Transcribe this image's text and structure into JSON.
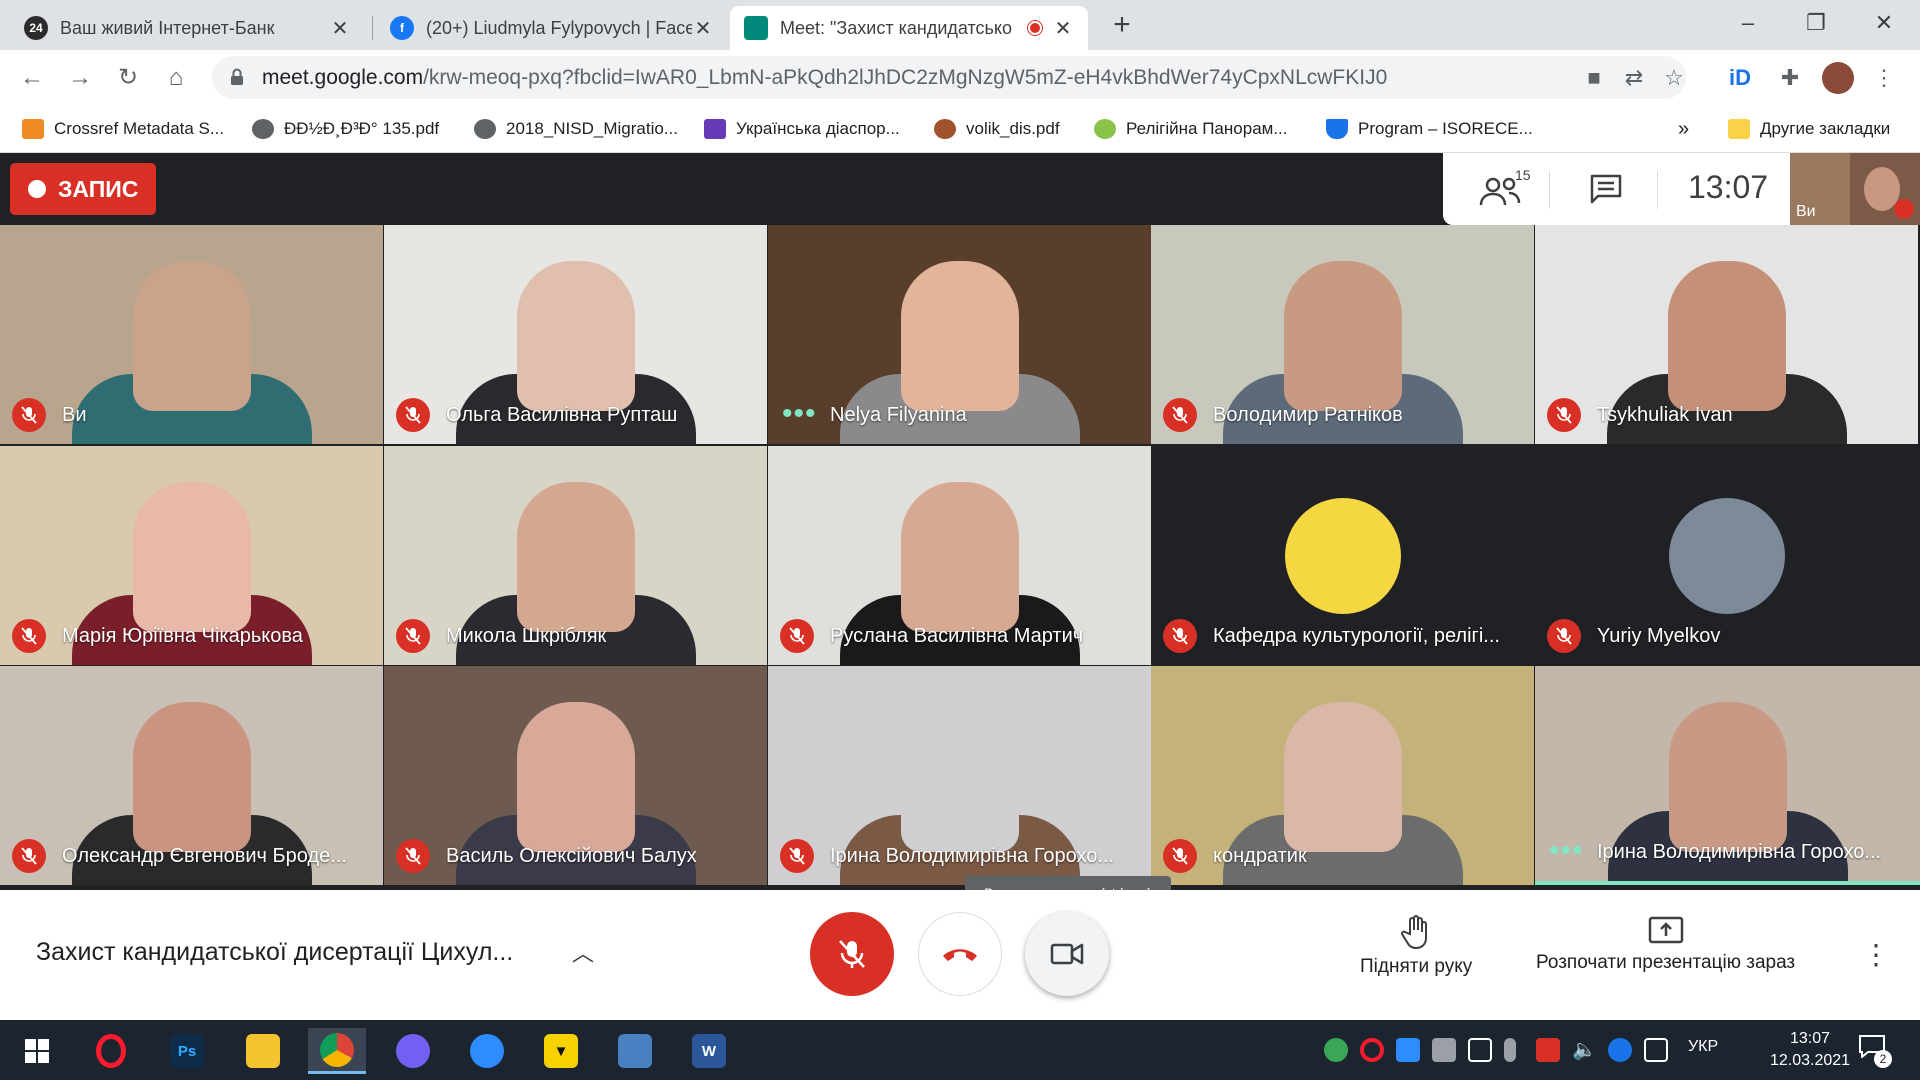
{
  "tabs": [
    {
      "title": "Ваш живий Інтернет-Банк",
      "icon": "privat24-icon",
      "icon_text": "24"
    },
    {
      "title": "(20+) Liudmyla Fylypovych | Face",
      "icon": "facebook-icon",
      "icon_text": "f"
    },
    {
      "title": "Meet: \"Захист кандидатсько",
      "icon": "google-meet-icon",
      "icon_text": ""
    }
  ],
  "address": {
    "domain": "meet.google.com",
    "path": "/krw-meoq-pxq?fbclid=IwAR0_LbmN-aPkQdh2lJhDC2zMgNzgW5mZ-eH4vkBhdWer74yCpxNLcwFKIJ0"
  },
  "bookmarks": [
    {
      "label": "Crossref Metadata S...",
      "color": "#f08a24"
    },
    {
      "label": "ÐÐ½Ð¸Ð³Ð° 135.pdf",
      "color": "#5f6368"
    },
    {
      "label": "2018_NISD_Migratio...",
      "color": "#5f6368"
    },
    {
      "label": "Українська діаспор...",
      "color": "#673ab7"
    },
    {
      "label": "volik_dis.pdf",
      "color": "#a0522d"
    },
    {
      "label": "Релігійна Панорам...",
      "color": "#8bc34a"
    },
    {
      "label": "Program – ISORECE...",
      "color": "#1a73e8"
    }
  ],
  "bookmarks_more": "»",
  "other_bookmarks": "Другие закладки",
  "meet": {
    "recording_label": "ЗАПИС",
    "participants_count": "15",
    "time": "13:07",
    "self_label": "Ви",
    "tooltip": "Вимкнути камеру (ctrl + e)",
    "title": "Захист кандидатської дисертації Цихул...",
    "raise_hand": "Підняти руку",
    "present": "Розпочати презентацію зараз"
  },
  "participants": [
    {
      "name": "Ви",
      "muted": true,
      "bg": "#b9a48e",
      "skin": "#c9a38a",
      "cloth": "#2f6d72",
      "kind": "video"
    },
    {
      "name": "Ольга Василівна Рупташ",
      "muted": true,
      "bg": "#e8e6e2",
      "skin": "#e0bfae",
      "cloth": "#2a2a2e",
      "kind": "video"
    },
    {
      "name": "Nelya Filyanina",
      "muted": false,
      "bg": "#5a3e2c",
      "skin": "#e2b49a",
      "cloth": "#8a8a8a",
      "kind": "video"
    },
    {
      "name": "Володимир Ратніков",
      "muted": true,
      "bg": "#c9c8bd",
      "skin": "#c89a82",
      "cloth": "#5c6a7a",
      "kind": "video"
    },
    {
      "name": "Tsykhuliak Ivan",
      "muted": true,
      "bg": "#e4e4e4",
      "skin": "#c49078",
      "cloth": "#2a2a2a",
      "kind": "video"
    },
    {
      "name": "Марія Юріївна Чікарькова",
      "muted": true,
      "bg": "#d9c9ae",
      "skin": "#e8b8a8",
      "cloth": "#7a1f2a",
      "kind": "video"
    },
    {
      "name": "Микола Шкрібляк",
      "muted": true,
      "bg": "#d8d4c6",
      "skin": "#d4a890",
      "cloth": "#2a2a30",
      "kind": "video"
    },
    {
      "name": "Руслана Василівна Мартич",
      "muted": true,
      "bg": "#dfdfdc",
      "skin": "#d6aa92",
      "cloth": "#1a1a1a",
      "kind": "video"
    },
    {
      "name": "Кафедра культурології, релігі...",
      "muted": true,
      "bg": "#202124",
      "avatar": "#f5d742",
      "kind": "avatar"
    },
    {
      "name": "Yuriy Myelkov",
      "muted": true,
      "bg": "#202124",
      "avatar": "#7d8a9a",
      "kind": "avatar"
    },
    {
      "name": "Олександр Євгенович Броде...",
      "muted": true,
      "bg": "#c8c0b4",
      "skin": "#c99580",
      "cloth": "#2a2a2a",
      "kind": "video"
    },
    {
      "name": "Василь Олексійович Балух",
      "muted": true,
      "bg": "#6e5a4e",
      "skin": "#d8a898",
      "cloth": "#3a3a48",
      "kind": "video"
    },
    {
      "name": "Ірина Володимирівна Горохо...",
      "muted": true,
      "bg": "#cfcfd2",
      "skin": "#cfcfd2",
      "cloth": "#7a5a45",
      "kind": "video"
    },
    {
      "name": "кондратик",
      "muted": true,
      "bg": "#c4b27a",
      "skin": "#d9b8a8",
      "cloth": "#6c6c6c",
      "kind": "video"
    },
    {
      "name": "Ірина Володимирівна Горохо...",
      "muted": false,
      "bg": "#c2b7a8",
      "skin": "#c89a86",
      "cloth": "#2e3240",
      "kind": "video"
    }
  ],
  "taskbar": {
    "lang": "УКР",
    "time": "13:07",
    "date": "12.03.2021",
    "notifications": "2"
  }
}
